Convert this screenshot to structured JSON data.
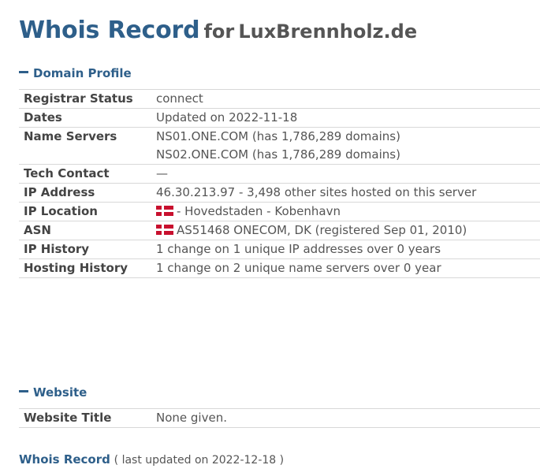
{
  "header": {
    "title_main": "Whois Record",
    "title_for": "for",
    "domain": "LuxBrennholz.de"
  },
  "sections": {
    "domain_profile": {
      "label": "Domain Profile",
      "rows": {
        "registrar_status": {
          "label": "Registrar Status",
          "value": "connect"
        },
        "dates": {
          "label": "Dates",
          "value": "Updated on 2022-11-18"
        },
        "name_servers": {
          "label": "Name Servers",
          "line1": "NS01.ONE.COM (has 1,786,289 domains)",
          "line2": "NS02.ONE.COM (has 1,786,289 domains)"
        },
        "tech_contact": {
          "label": "Tech Contact",
          "value": "—"
        },
        "ip_address": {
          "label": "IP Address",
          "value": "46.30.213.97 - 3,498 other sites hosted on this server"
        },
        "ip_location": {
          "label": "IP Location",
          "value": "- Hovedstaden - Kobenhavn",
          "flag": "denmark-flag"
        },
        "asn": {
          "label": "ASN",
          "value": "AS51468 ONECOM, DK (registered Sep 01, 2010)",
          "flag": "denmark-flag"
        },
        "ip_history": {
          "label": "IP History",
          "value": "1 change on 1 unique IP addresses over 0 years"
        },
        "hosting_history": {
          "label": "Hosting History",
          "value": "1 change on 2 unique name servers over 0 year"
        }
      }
    },
    "website": {
      "label": "Website",
      "rows": {
        "website_title": {
          "label": "Website Title",
          "value": "None given."
        }
      }
    }
  },
  "footer": {
    "link_label": "Whois Record",
    "meta": "( last updated on 2022-12-18 )"
  },
  "colors": {
    "accent": "#2e5f8a",
    "text": "#555555",
    "border": "#d8d8d8"
  }
}
